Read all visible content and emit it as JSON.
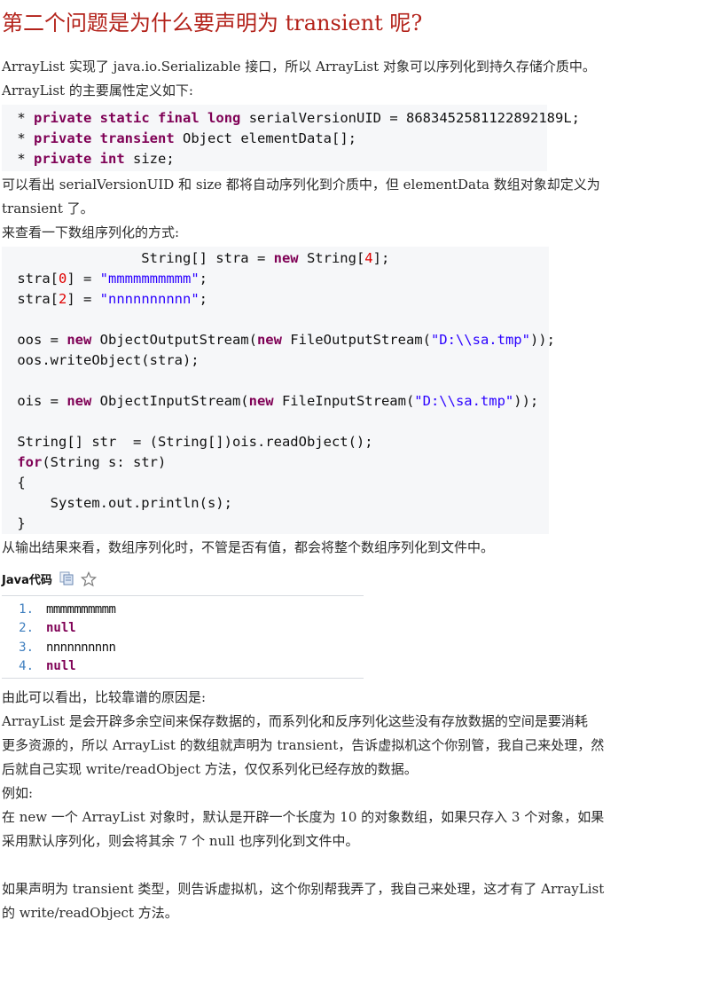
{
  "title": "第二个问题是为什么要声明为 transient 呢?",
  "p1": "ArrayList 实现了 java.io.Serializable 接口，所以 ArrayList 对象可以序列化到持久存储介质中。",
  "p2": "ArrayList 的主要属性定义如下:",
  "code1": {
    "line1": {
      "star": " * ",
      "kw1": "private",
      "kw2": "static",
      "kw3": "final",
      "kw4": "long",
      "rest": "serialVersionUID = ",
      "number": "8683452581122892189L",
      "end": ";"
    },
    "line2": {
      "star": " * ",
      "kw1": "private",
      "kw2": "transient",
      "rest": "Object elementData[];"
    },
    "line3": {
      "star": " * ",
      "kw1": "private",
      "kw2": "int",
      "rest": "size;"
    }
  },
  "p3": "可以看出 serialVersionUID 和 size 都将自动序列化到介质中，但 elementData 数组对象却定义为",
  "p4": "transient 了。",
  "p5": "来查看一下数组序列化的方式:",
  "code2": {
    "l1a": "                String[] stra = ",
    "l1kw": "new",
    "l1b": " String[",
    "l1n": "4",
    "l1c": "];",
    "l2a": " stra[",
    "l2n": "0",
    "l2b": "] = ",
    "l2s": "\"mmmmmmmmmm\"",
    "l2c": ";",
    "l3a": " stra[",
    "l3n": "2",
    "l3b": "] = ",
    "l3s": "\"nnnnnnnnnn\"",
    "l3c": ";",
    "l5a": " oos = ",
    "l5kw1": "new",
    "l5b": " ObjectOutputStream(",
    "l5kw2": "new",
    "l5c": " FileOutputStream(",
    "l5s": "\"D:\\\\sa.tmp\"",
    "l5d": "));",
    "l6": " oos.writeObject(stra);",
    "l8a": " ois = ",
    "l8kw1": "new",
    "l8b": " ObjectInputStream(",
    "l8kw2": "new",
    "l8c": " FileInputStream(",
    "l8s": "\"D:\\\\sa.tmp\"",
    "l8d": "));",
    "l10": " String[] str  = (String[])ois.readObject();",
    "l11kw": "for",
    "l11": "(String s: str)",
    "l12": " {",
    "l13": "     System.out.println(s);",
    "l14": " }"
  },
  "p6": "从输出结果来看，数组序列化时，不管是否有值，都会将整个数组序列化到文件中。",
  "java_title": "Java代码",
  "icons": {
    "copy": "copy-icon",
    "star": "star-icon"
  },
  "output_lines": [
    {
      "num": "1.",
      "text": "mmmmmmmmmm"
    },
    {
      "num": "2.",
      "text": "null"
    },
    {
      "num": "3.",
      "text": "nnnnnnnnnn"
    },
    {
      "num": "4.",
      "text": "null"
    }
  ],
  "p7": "由此可以看出，比较靠谱的原因是:",
  "p8": "ArrayList 是会开辟多余空间来保存数据的，而系列化和反序列化这些没有存放数据的空间是要消耗",
  "p9": "更多资源的，所以 ArrayList 的数组就声明为 transient，告诉虚拟机这个你别管，我自己来处理，然",
  "p10": "后就自己实现 write/readObject 方法，仅仅系列化已经存放的数据。",
  "p11": "例如:",
  "p12": "在 new 一个 ArrayList 对象时，默认是开辟一个长度为 10 的对象数组，如果只存入 3 个对象，如果",
  "p13": "采用默认序列化，则会将其余 7 个 null 也序列化到文件中。",
  "p14": "如果声明为 transient 类型，则告诉虚拟机，这个你别帮我弄了，我自己来处理，这才有了 ArrayList",
  "p15": "的 write/readObject 方法。",
  "colors": {
    "title": "#b3221a",
    "keyword": "#7f0055",
    "string": "#2a00ff",
    "number": "#e00000",
    "code_bg": "#f6f7f9"
  }
}
